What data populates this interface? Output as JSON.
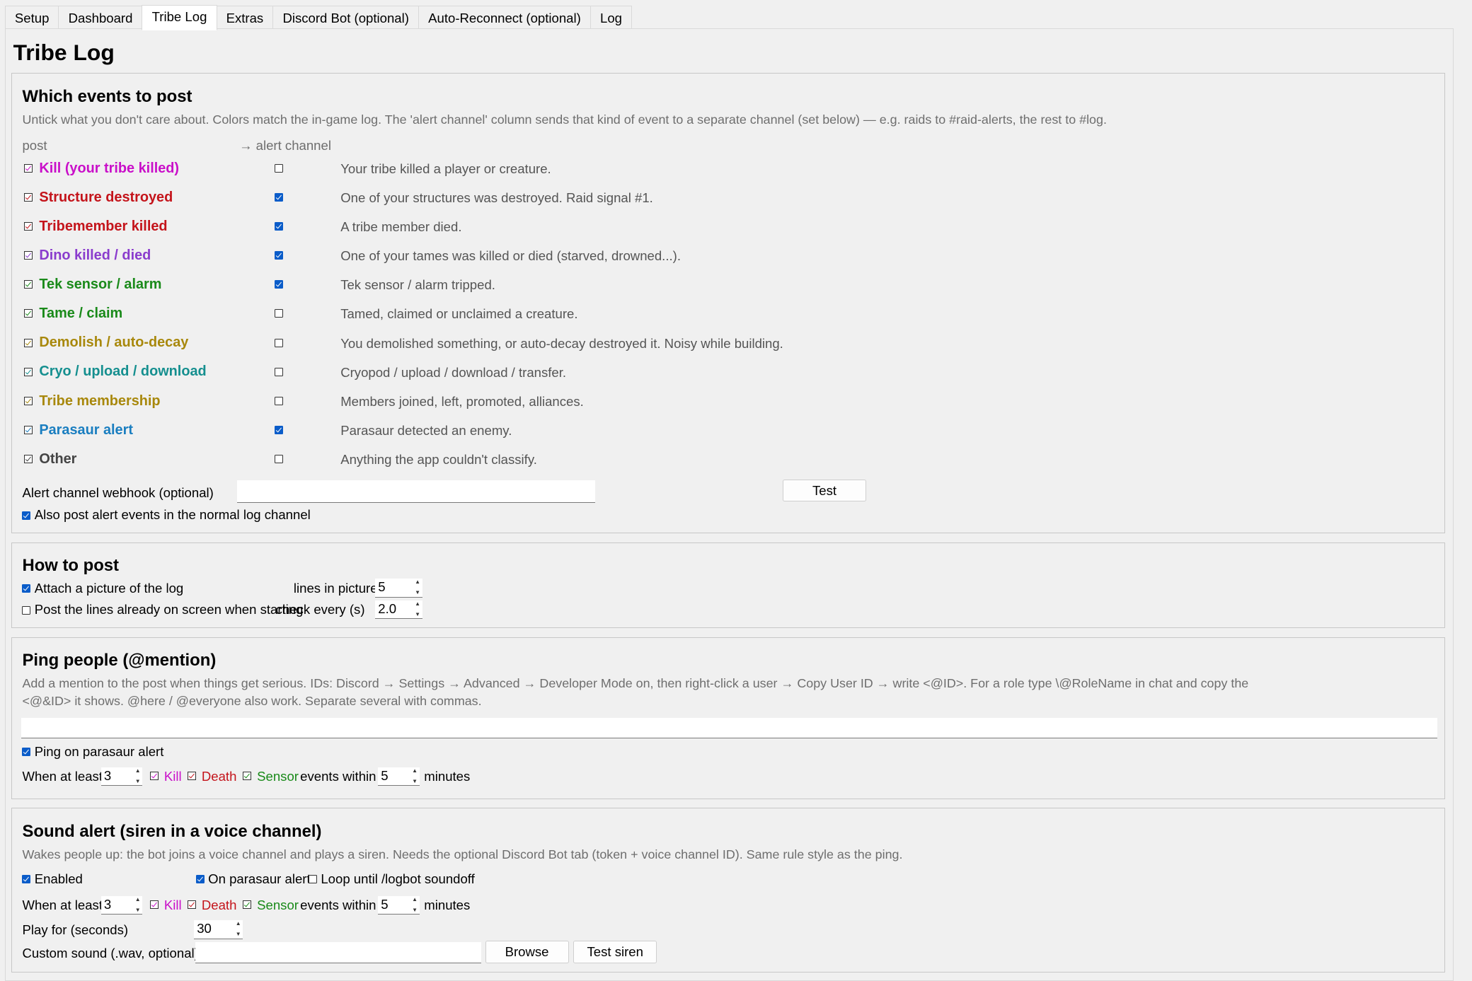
{
  "tabs": [
    "Setup",
    "Dashboard",
    "Tribe Log",
    "Extras",
    "Discord Bot (optional)",
    "Auto-Reconnect (optional)",
    "Log"
  ],
  "page_title": "Tribe Log",
  "events_section": {
    "title": "Which events to post",
    "hint": "Untick what you don't care about. Colors match the in-game log. The 'alert channel' column sends that kind of event to a separate channel (set below) — e.g. raids to #raid-alerts, the rest to #log.",
    "col_post": "post",
    "col_alert": "→ alert channel",
    "events": [
      {
        "label": "Kill (your tribe killed)",
        "color": "#c90fc9",
        "post": true,
        "alert": false,
        "desc": "Your tribe killed a player or creature."
      },
      {
        "label": "Structure destroyed",
        "color": "#c4141b",
        "post": true,
        "alert": true,
        "desc": "One of your structures was destroyed. Raid signal #1."
      },
      {
        "label": "Tribemember killed",
        "color": "#c4141b",
        "post": true,
        "alert": true,
        "desc": "A tribe member died."
      },
      {
        "label": "Dino killed / died",
        "color": "#8a3ccd",
        "post": true,
        "alert": true,
        "desc": "One of your tames was killed or died (starved, drowned...)."
      },
      {
        "label": "Tek sensor / alarm",
        "color": "#1a8a1a",
        "post": true,
        "alert": true,
        "desc": "Tek sensor / alarm tripped."
      },
      {
        "label": "Tame / claim",
        "color": "#1a8a1a",
        "post": true,
        "alert": false,
        "desc": "Tamed, claimed or unclaimed a creature."
      },
      {
        "label": "Demolish / auto-decay",
        "color": "#a8880c",
        "post": true,
        "alert": false,
        "desc": "You demolished something, or auto-decay destroyed it. Noisy while building."
      },
      {
        "label": "Cryo / upload / download",
        "color": "#158f8f",
        "post": true,
        "alert": false,
        "desc": "Cryopod / upload / download / transfer."
      },
      {
        "label": "Tribe membership",
        "color": "#a8880c",
        "post": true,
        "alert": false,
        "desc": "Members joined, left, promoted, alliances."
      },
      {
        "label": "Parasaur alert",
        "color": "#1a7ec0",
        "post": true,
        "alert": true,
        "desc": "Parasaur detected an enemy."
      },
      {
        "label": "Other",
        "color": "#444444",
        "post": true,
        "alert": false,
        "desc": "Anything the app couldn't classify."
      }
    ],
    "webhook_label": "Alert channel webhook (optional)",
    "webhook_value": "",
    "test_label": "Test",
    "also_post_label": "Also post alert events in the normal log channel"
  },
  "how_section": {
    "title": "How to post",
    "attach_label": "Attach a picture of the log",
    "lines_label": "lines in picture",
    "lines_value": "5",
    "post_lines_label": "Post the lines already on screen when starting",
    "check_label": "check every (s)",
    "check_value": "2.0"
  },
  "ping_section": {
    "title": "Ping people (@mention)",
    "hint1": "Add a mention to the post when things get serious. IDs: Discord → Settings → Advanced → Developer Mode on, then right-click a user → Copy User ID → write <@ID>. For a role type \\@RoleName in chat and copy the",
    "hint2": "<@&ID> it shows. @here / @everyone also work. Separate several with commas.",
    "mention_value": "",
    "ping_parasaur_label": "Ping on parasaur alert",
    "when_label": "When at least",
    "count_value": "3",
    "kill_label": "Kill",
    "death_label": "Death",
    "sensor_label": "Sensor",
    "within_label": "events within",
    "within_value": "5",
    "minutes_label": "minutes"
  },
  "sound_section": {
    "title": "Sound alert (siren in a voice channel)",
    "hint": "Wakes people up: the bot joins a voice channel and plays a siren. Needs the optional Discord Bot tab (token + voice channel ID). Same rule style as the ping.",
    "enabled_label": "Enabled",
    "on_parasaur_label": "On parasaur alert",
    "loop_label": "Loop until /logbot soundoff",
    "when_label": "When at least",
    "count_value": "3",
    "kill_label": "Kill",
    "death_label": "Death",
    "sensor_label": "Sensor",
    "within_label": "events within",
    "within_value": "5",
    "minutes_label": "minutes",
    "play_label": "Play for (seconds)",
    "play_value": "30",
    "custom_label": "Custom sound (.wav, optional)",
    "custom_value": "",
    "browse_label": "Browse",
    "test_siren_label": "Test siren"
  },
  "colors": {
    "kill": "#c90fc9",
    "death": "#c4141b",
    "sensor": "#1a8a1a"
  }
}
